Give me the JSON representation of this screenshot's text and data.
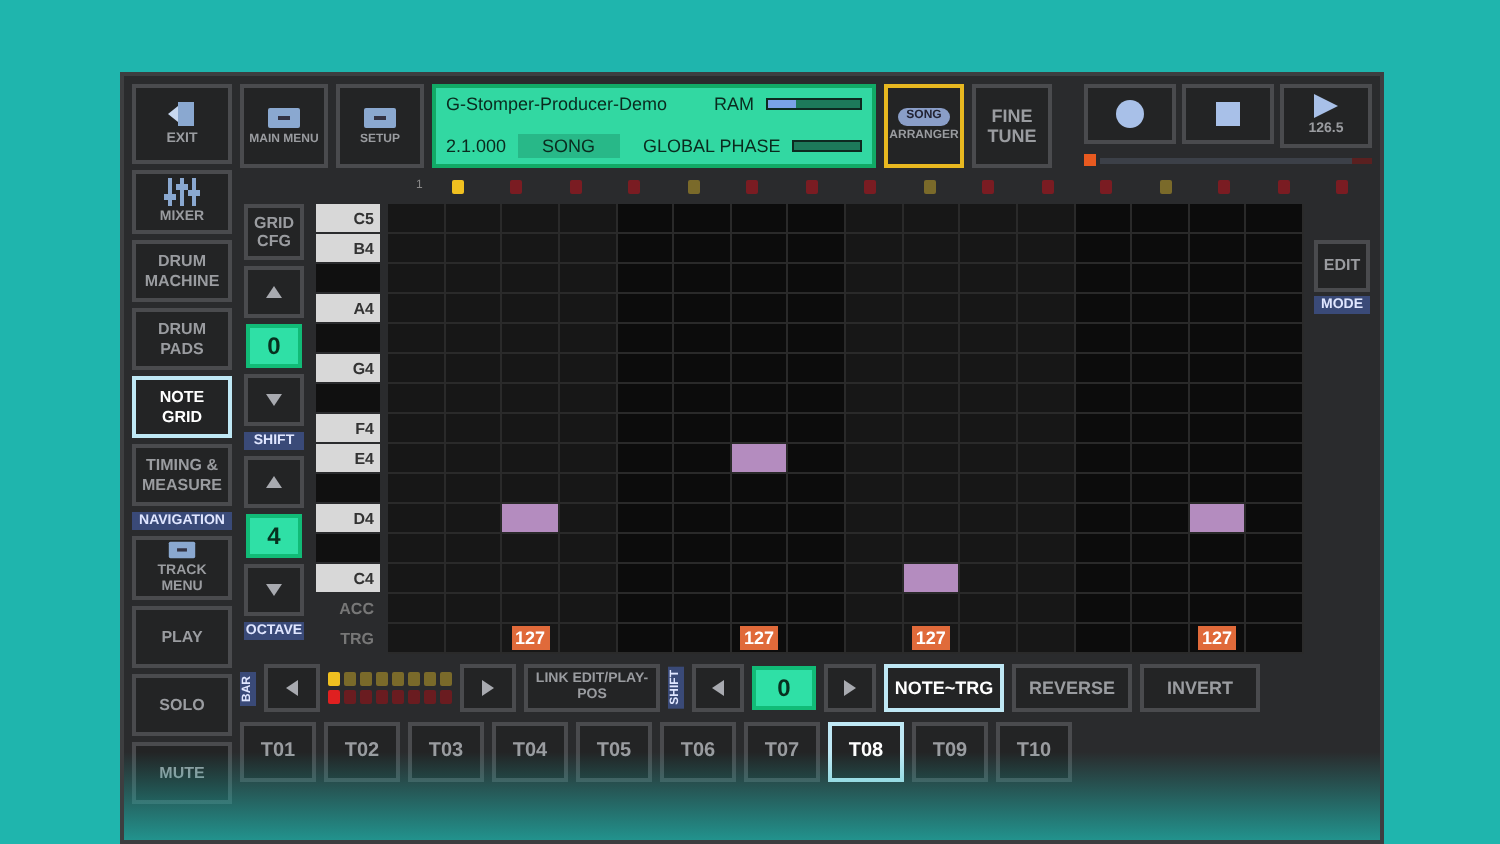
{
  "sidebar": {
    "items": [
      {
        "label": "EXIT",
        "kind": "exit",
        "selected": false
      },
      {
        "label": "MIXER",
        "kind": "mixer",
        "selected": false
      },
      {
        "label": "DRUM MACHINE",
        "kind": "text",
        "selected": false
      },
      {
        "label": "DRUM PADS",
        "kind": "text",
        "selected": false
      },
      {
        "label": "NOTE GRID",
        "kind": "text",
        "selected": true
      },
      {
        "label": "TIMING & MEASURE",
        "kind": "text",
        "selected": false
      },
      {
        "label": "NAVIGATION",
        "kind": "tag"
      },
      {
        "label": "TRACK MENU",
        "kind": "menu",
        "selected": false
      },
      {
        "label": "PLAY",
        "kind": "text",
        "selected": false
      },
      {
        "label": "SOLO",
        "kind": "text",
        "selected": false
      },
      {
        "label": "MUTE",
        "kind": "text",
        "selected": false
      }
    ]
  },
  "header": {
    "buttons": [
      {
        "label": "MAIN MENU"
      },
      {
        "label": "SETUP"
      }
    ],
    "display": {
      "title": "G-Stomper-Producer-Demo",
      "version": "2.1.000",
      "mode": "SONG",
      "meters": [
        {
          "label": "RAM",
          "level": 0.3
        },
        {
          "label": "GLOBAL PHASE"
        }
      ]
    },
    "arranger": {
      "badge": "SONG",
      "label": "ARRANGER",
      "selected": true
    },
    "fine_tune": "FINE TUNE",
    "transport": [
      {
        "kind": "record"
      },
      {
        "kind": "stop"
      },
      {
        "kind": "play",
        "text": "126.5"
      }
    ]
  },
  "steps": {
    "first_label": "1",
    "markers": [
      {
        "color": "#f0c020"
      },
      {
        "color": "#7a1c22"
      },
      {
        "color": "#7a1c22"
      },
      {
        "color": "#7a1c22"
      },
      {
        "color": "#7a6a2a"
      },
      {
        "color": "#7a1c22"
      },
      {
        "color": "#7a1c22"
      },
      {
        "color": "#7a1c22"
      },
      {
        "color": "#7a6a2a"
      },
      {
        "color": "#7a1c22"
      },
      {
        "color": "#7a1c22"
      },
      {
        "color": "#7a1c22"
      },
      {
        "color": "#7a6a2a"
      },
      {
        "color": "#7a1c22"
      },
      {
        "color": "#7a1c22"
      },
      {
        "color": "#7a1c22"
      }
    ]
  },
  "editor": {
    "grid_cfg": "GRID CFG",
    "shift": {
      "value": "0",
      "label": "SHIFT"
    },
    "octave": {
      "value": "4",
      "label": "OCTAVE"
    },
    "keys": [
      {
        "label": "C5",
        "kind": "white",
        "steps": [
          false,
          false,
          false,
          false,
          false,
          false,
          false,
          false,
          false,
          false,
          false,
          false,
          false,
          false,
          false,
          false
        ]
      },
      {
        "label": "B4",
        "kind": "white",
        "steps": [
          false,
          false,
          false,
          false,
          false,
          false,
          false,
          false,
          false,
          false,
          false,
          false,
          false,
          false,
          false,
          false
        ]
      },
      {
        "kind": "black",
        "steps": [
          false,
          false,
          false,
          false,
          false,
          false,
          false,
          false,
          false,
          false,
          false,
          false,
          false,
          false,
          false,
          false
        ]
      },
      {
        "label": "A4",
        "kind": "white",
        "steps": [
          false,
          false,
          false,
          false,
          false,
          false,
          false,
          false,
          false,
          false,
          false,
          false,
          false,
          false,
          false,
          false
        ]
      },
      {
        "kind": "black",
        "steps": [
          false,
          false,
          false,
          false,
          false,
          false,
          false,
          false,
          false,
          false,
          false,
          false,
          false,
          false,
          false,
          false
        ]
      },
      {
        "label": "G4",
        "kind": "white",
        "steps": [
          false,
          false,
          false,
          false,
          false,
          false,
          false,
          false,
          false,
          false,
          false,
          false,
          false,
          false,
          false,
          false
        ]
      },
      {
        "kind": "black",
        "steps": [
          false,
          false,
          false,
          false,
          false,
          false,
          false,
          false,
          false,
          false,
          false,
          false,
          false,
          false,
          false,
          false
        ]
      },
      {
        "label": "F4",
        "kind": "white",
        "steps": [
          false,
          false,
          false,
          false,
          false,
          false,
          false,
          false,
          false,
          false,
          false,
          false,
          false,
          false,
          false,
          false
        ]
      },
      {
        "label": "E4",
        "kind": "white",
        "steps": [
          false,
          false,
          false,
          false,
          false,
          false,
          true,
          false,
          false,
          false,
          false,
          false,
          false,
          false,
          false,
          false
        ]
      },
      {
        "kind": "black",
        "steps": [
          false,
          false,
          false,
          false,
          false,
          false,
          false,
          false,
          false,
          false,
          false,
          false,
          false,
          false,
          false,
          false
        ]
      },
      {
        "label": "D4",
        "kind": "white",
        "steps": [
          false,
          false,
          true,
          false,
          false,
          false,
          false,
          false,
          false,
          false,
          false,
          false,
          false,
          false,
          true,
          false
        ]
      },
      {
        "kind": "black",
        "steps": [
          false,
          false,
          false,
          false,
          false,
          false,
          false,
          false,
          false,
          false,
          false,
          false,
          false,
          false,
          false,
          false
        ]
      },
      {
        "label": "C4",
        "kind": "white",
        "steps": [
          false,
          false,
          false,
          false,
          false,
          false,
          false,
          false,
          false,
          true,
          false,
          false,
          false,
          false,
          false,
          false
        ]
      }
    ],
    "acc_label": "ACC",
    "trg_label": "TRG",
    "trg": [
      {
        "set": false
      },
      {
        "set": false
      },
      {
        "set": true,
        "value": "127"
      },
      {
        "set": false
      },
      {
        "set": false
      },
      {
        "set": false
      },
      {
        "set": true,
        "value": "127"
      },
      {
        "set": false
      },
      {
        "set": false
      },
      {
        "set": true,
        "value": "127"
      },
      {
        "set": false
      },
      {
        "set": false
      },
      {
        "set": false
      },
      {
        "set": false
      },
      {
        "set": true,
        "value": "127"
      },
      {
        "set": false
      }
    ],
    "edit": "EDIT",
    "mode": "MODE"
  },
  "bottom": {
    "bar_label": "BAR",
    "patterns": [
      {
        "selected": true
      },
      {
        "selected": false
      },
      {
        "selected": false
      },
      {
        "selected": false
      },
      {
        "selected": false
      },
      {
        "selected": false
      },
      {
        "selected": false
      },
      {
        "selected": false
      }
    ],
    "link": "LINK EDIT/PLAY-POS",
    "shift_label": "SHIFT",
    "shift_value": "0",
    "actions": [
      {
        "label": "NOTE~TRG",
        "selected": true
      },
      {
        "label": "REVERSE",
        "selected": false
      },
      {
        "label": "INVERT",
        "selected": false
      }
    ]
  },
  "tracks": [
    {
      "label": "T01",
      "selected": false
    },
    {
      "label": "T02",
      "selected": false
    },
    {
      "label": "T03",
      "selected": false
    },
    {
      "label": "T04",
      "selected": false
    },
    {
      "label": "T05",
      "selected": false
    },
    {
      "label": "T06",
      "selected": false
    },
    {
      "label": "T07",
      "selected": false
    },
    {
      "label": "T08",
      "selected": true
    },
    {
      "label": "T09",
      "selected": false
    },
    {
      "label": "T10",
      "selected": false
    }
  ]
}
